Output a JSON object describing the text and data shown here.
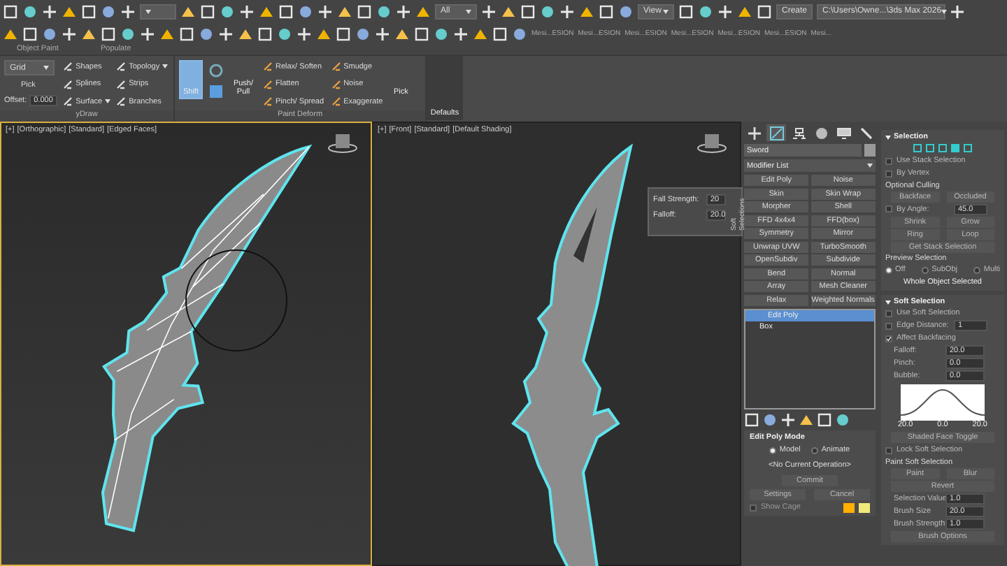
{
  "toolbar": {
    "selection_filter": "All",
    "view_dropdown": "View",
    "create_button": "Create",
    "project_path": "C:\\Users\\Owne...\\3ds Max 2026",
    "scene_states": [
      "Mesi...ESION",
      "Mesi...ESION",
      "Mesi...ESION",
      "Mesi...ESION",
      "Mesi...ESION",
      "Mesi...ESION",
      "Mesi..."
    ]
  },
  "ribbon": {
    "group_labels": [
      "Object Paint",
      "Populate"
    ],
    "poly_draw": {
      "grid_dropdown": "Grid",
      "pick": "Pick",
      "offset_label": "Offset:",
      "offset_value": "0.000",
      "footer": "yDraw",
      "tools": [
        {
          "label": "Shapes",
          "has_menu": false
        },
        {
          "label": "Topology",
          "has_menu": true
        },
        {
          "label": "Splines",
          "has_menu": false
        },
        {
          "label": "Strips",
          "has_menu": false
        },
        {
          "label": "Surface",
          "has_menu": true
        },
        {
          "label": "Branches",
          "has_menu": false
        }
      ]
    },
    "paint_deform": {
      "shift": {
        "label": "Shift",
        "selected": true
      },
      "push_pull": "Push/ Pull",
      "tools": [
        "Relax/ Soften",
        "Smudge",
        "Flatten",
        "Noise",
        "Pinch/ Spread",
        "Exaggerate"
      ],
      "pick": "Pick",
      "footer": "Paint Deform"
    },
    "defaults": "Defaults"
  },
  "viewports": [
    {
      "labels": [
        "[+]",
        "[Orthographic]",
        "[Standard]",
        "[Edged Faces]"
      ],
      "active": true,
      "kind": "wireframe"
    },
    {
      "labels": [
        "[+]",
        "[Front]",
        "[Standard]",
        "[Default Shading]"
      ],
      "active": false,
      "kind": "shaded"
    }
  ],
  "soft_selections_float": {
    "fields": [
      {
        "label": "Fall Strength:",
        "value": "20"
      },
      {
        "label": "Falloff:",
        "value": "20.0"
      }
    ],
    "tab": "Soft Selections"
  },
  "command_panel": {
    "tabs": [
      {
        "kind": "create",
        "selected": false
      },
      {
        "kind": "modify",
        "selected": true
      },
      {
        "kind": "hierarchy",
        "selected": false
      },
      {
        "kind": "motion",
        "selected": false
      },
      {
        "kind": "display",
        "selected": false
      },
      {
        "kind": "utilities",
        "selected": false
      }
    ],
    "object_name": "Sword",
    "modifier_list": "Modifier List",
    "modifier_buttons": [
      "Edit Poly",
      "Noise",
      "Skin",
      "Skin Wrap",
      "Morpher",
      "Shell",
      "FFD 4x4x4",
      "FFD(box)",
      "Symmetry",
      "Mirror",
      "Unwrap UVW",
      "TurboSmooth",
      "OpenSubdiv",
      "Subdivide",
      "Bend",
      "Normal",
      "Array",
      "Mesh Cleaner",
      "Relax",
      "Weighted Normals"
    ],
    "stack": [
      {
        "label": "Edit Poly",
        "selected": true
      },
      {
        "label": "Box",
        "selected": false
      }
    ],
    "edit_poly_mode": {
      "title": "Edit Poly Mode",
      "modes": [
        {
          "label": "Model",
          "selected": true
        },
        {
          "label": "Animate",
          "selected": false
        }
      ],
      "operation": "<No Current Operation>",
      "commit": "Commit",
      "settings": "Settings",
      "cancel": "Cancel",
      "show_cage": {
        "label": "Show Cage",
        "checked": false
      },
      "cage_colors": [
        {
          "color": "#ffb000"
        },
        {
          "color": "#f0e87a"
        }
      ]
    }
  },
  "rollouts": [
    {
      "title": "Selection",
      "rows": [
        {
          "kind": "icons"
        },
        {
          "kind": "checkbox",
          "label": "Use Stack Selection",
          "checked": false
        },
        {
          "kind": "checkbox",
          "label": "By Vertex",
          "checked": false
        },
        {
          "kind": "group",
          "label": "Optional Culling"
        },
        {
          "kind": "buttons",
          "labels": [
            "Backface",
            "Occluded"
          ]
        },
        {
          "kind": "check_spinner",
          "label": "By Angle:",
          "value": "45.0",
          "checked": false
        },
        {
          "kind": "buttons",
          "labels": [
            "Shrink",
            "Grow"
          ]
        },
        {
          "kind": "buttons",
          "labels": [
            "Ring",
            "Loop"
          ]
        },
        {
          "kind": "buttons",
          "labels": [
            "Get Stack Selection"
          ]
        },
        {
          "kind": "group",
          "label": "Preview Selection"
        },
        {
          "kind": "radios",
          "options": [
            {
              "label": "Off",
              "selected": true
            },
            {
              "label": "SubObj",
              "selected": false
            },
            {
              "label": "Multi",
              "selected": false
            }
          ]
        },
        {
          "kind": "text",
          "label": "Whole Object Selected"
        }
      ]
    },
    {
      "title": "Soft Selection",
      "rows": [
        {
          "kind": "checkbox",
          "label": "Use Soft Selection",
          "checked": false
        },
        {
          "kind": "check_spinner",
          "label": "Edge Distance:",
          "value": "1",
          "checked": false
        },
        {
          "kind": "checkbox",
          "label": "Affect Backfacing",
          "checked": true
        },
        {
          "kind": "spinner",
          "label": "Falloff:",
          "value": "20.0"
        },
        {
          "kind": "spinner",
          "label": "Pinch:",
          "value": "0.0"
        },
        {
          "kind": "spinner",
          "label": "Bubble:",
          "value": "0.0"
        },
        {
          "kind": "curve",
          "labels": [
            "20.0",
            "0.0",
            "20.0"
          ]
        },
        {
          "kind": "buttons",
          "labels": [
            "Shaded Face Toggle"
          ]
        },
        {
          "kind": "checkbox",
          "label": "Lock Soft Selection",
          "checked": false
        },
        {
          "kind": "group",
          "label": "Paint Soft Selection"
        },
        {
          "kind": "buttons",
          "labels": [
            "Paint",
            "Blur"
          ]
        },
        {
          "kind": "buttons",
          "labels": [
            "Revert"
          ]
        },
        {
          "kind": "spinner",
          "label": "Selection Value",
          "value": "1.0"
        },
        {
          "kind": "spinner",
          "label": "Brush Size",
          "value": "20.0"
        },
        {
          "kind": "spinner",
          "label": "Brush Strength",
          "value": "1.0"
        },
        {
          "kind": "buttons",
          "labels": [
            "Brush Options"
          ]
        }
      ]
    }
  ]
}
